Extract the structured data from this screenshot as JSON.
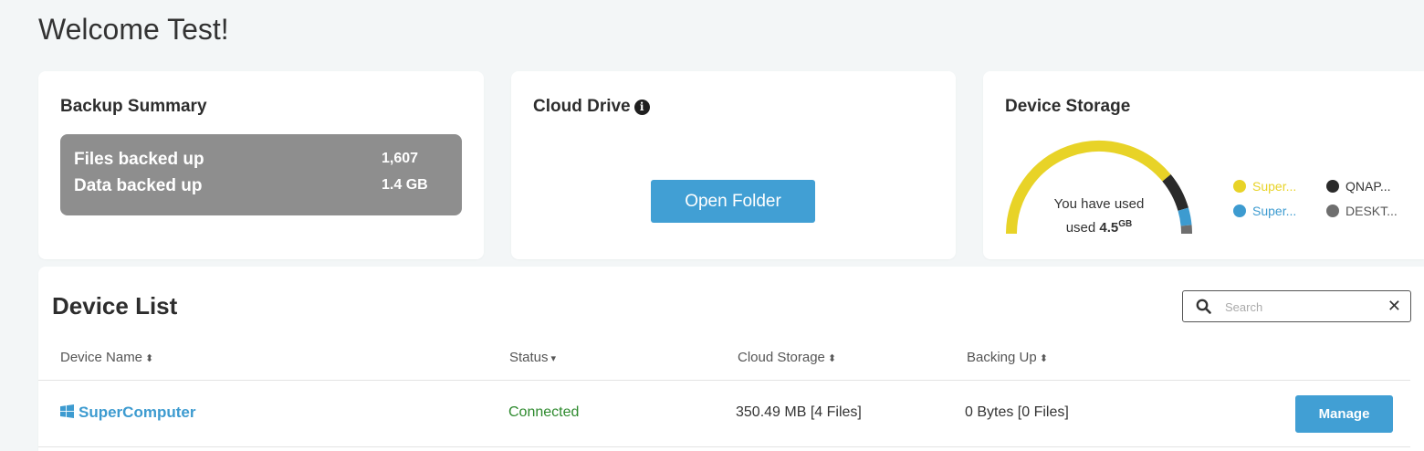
{
  "page": {
    "welcome": "Welcome Test!"
  },
  "backup_summary": {
    "title": "Backup Summary",
    "files_label": "Files backed up",
    "files_value": "1,607",
    "data_label": "Data backed up",
    "data_value": "1.4 GB"
  },
  "cloud_drive": {
    "title": "Cloud Drive",
    "info_icon": "info-icon",
    "button_label": "Open Folder"
  },
  "device_storage": {
    "title": "Device Storage",
    "used_text_1": "You have used",
    "used_text_2": "used",
    "used_value": "4.5",
    "used_unit": "GB",
    "segments": [
      {
        "legend": "Super...",
        "color": "#e8d327",
        "fraction": 0.78
      },
      {
        "legend": "QNAP...",
        "color": "#2a2a2a",
        "fraction": 0.13
      },
      {
        "legend": "Super...",
        "color": "#3d9bd0",
        "fraction": 0.06
      },
      {
        "legend": "DESKT...",
        "color": "#6e6e6e",
        "fraction": 0.03
      }
    ]
  },
  "device_list": {
    "title": "Device List",
    "search_placeholder": "Search",
    "columns": [
      "Device Name",
      "Status",
      "Cloud Storage",
      "Backing Up"
    ],
    "rows": [
      {
        "name": "SuperComputer",
        "status": "Connected",
        "cloud_storage": "350.49 MB [4 Files]",
        "backing_up": "0 Bytes [0 Files]",
        "action": "Manage"
      }
    ]
  },
  "colors": {
    "accent": "#419fd4",
    "connected": "#2e8a2e",
    "summary_bg": "#8e8e8e"
  }
}
